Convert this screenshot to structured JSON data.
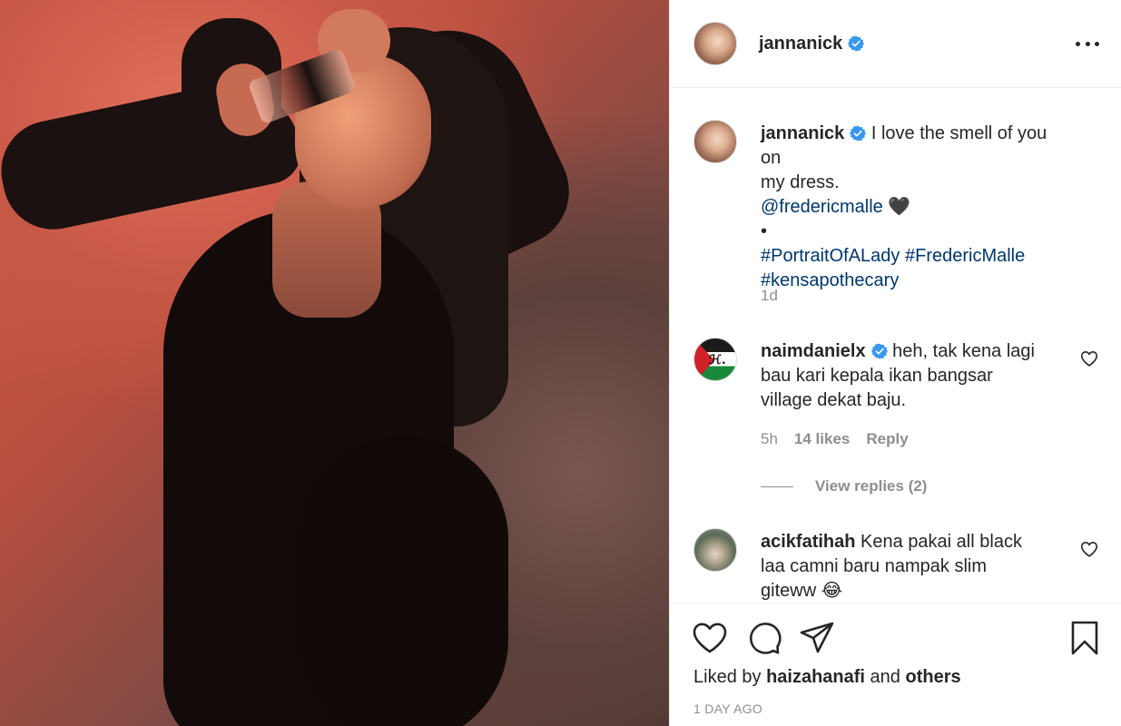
{
  "post": {
    "author": "jannanick",
    "verified": true,
    "photo_alt": "Woman in black dress holding perfume bottle against orange wall"
  },
  "caption": {
    "username": "jannanick",
    "line1": "I love the smell of you on",
    "line2": "my dress.",
    "mention": "@fredericmalle",
    "heart_emoji": "🖤",
    "bullet": "•",
    "hashtag1": "#PortraitOfALady",
    "hashtag2": "#FredericMalle",
    "hashtag3": "#kensapothecary",
    "time": "1d"
  },
  "comments": [
    {
      "username": "naimdanielx",
      "verified": true,
      "line1": "heh, tak kena lagi",
      "line2": "bau kari kepala ikan bangsar",
      "line3": "village dekat baju.",
      "time": "5h",
      "likes": "14 likes",
      "reply": "Reply",
      "view_replies": "View replies (2)"
    },
    {
      "username": "acikfatihah",
      "verified": false,
      "line1": "Kena pakai all black",
      "line2": "laa camni baru nampak slim",
      "line3": "giteww",
      "emoji": "😂"
    }
  ],
  "footer": {
    "liked_prefix": "Liked by",
    "liked_user": "haizahanafi",
    "liked_and": "and",
    "liked_others": "others",
    "date": "1 DAY AGO"
  },
  "colors": {
    "verified_blue": "#3897f0",
    "link": "#00376b",
    "secondary_text": "#8e8e8e"
  }
}
